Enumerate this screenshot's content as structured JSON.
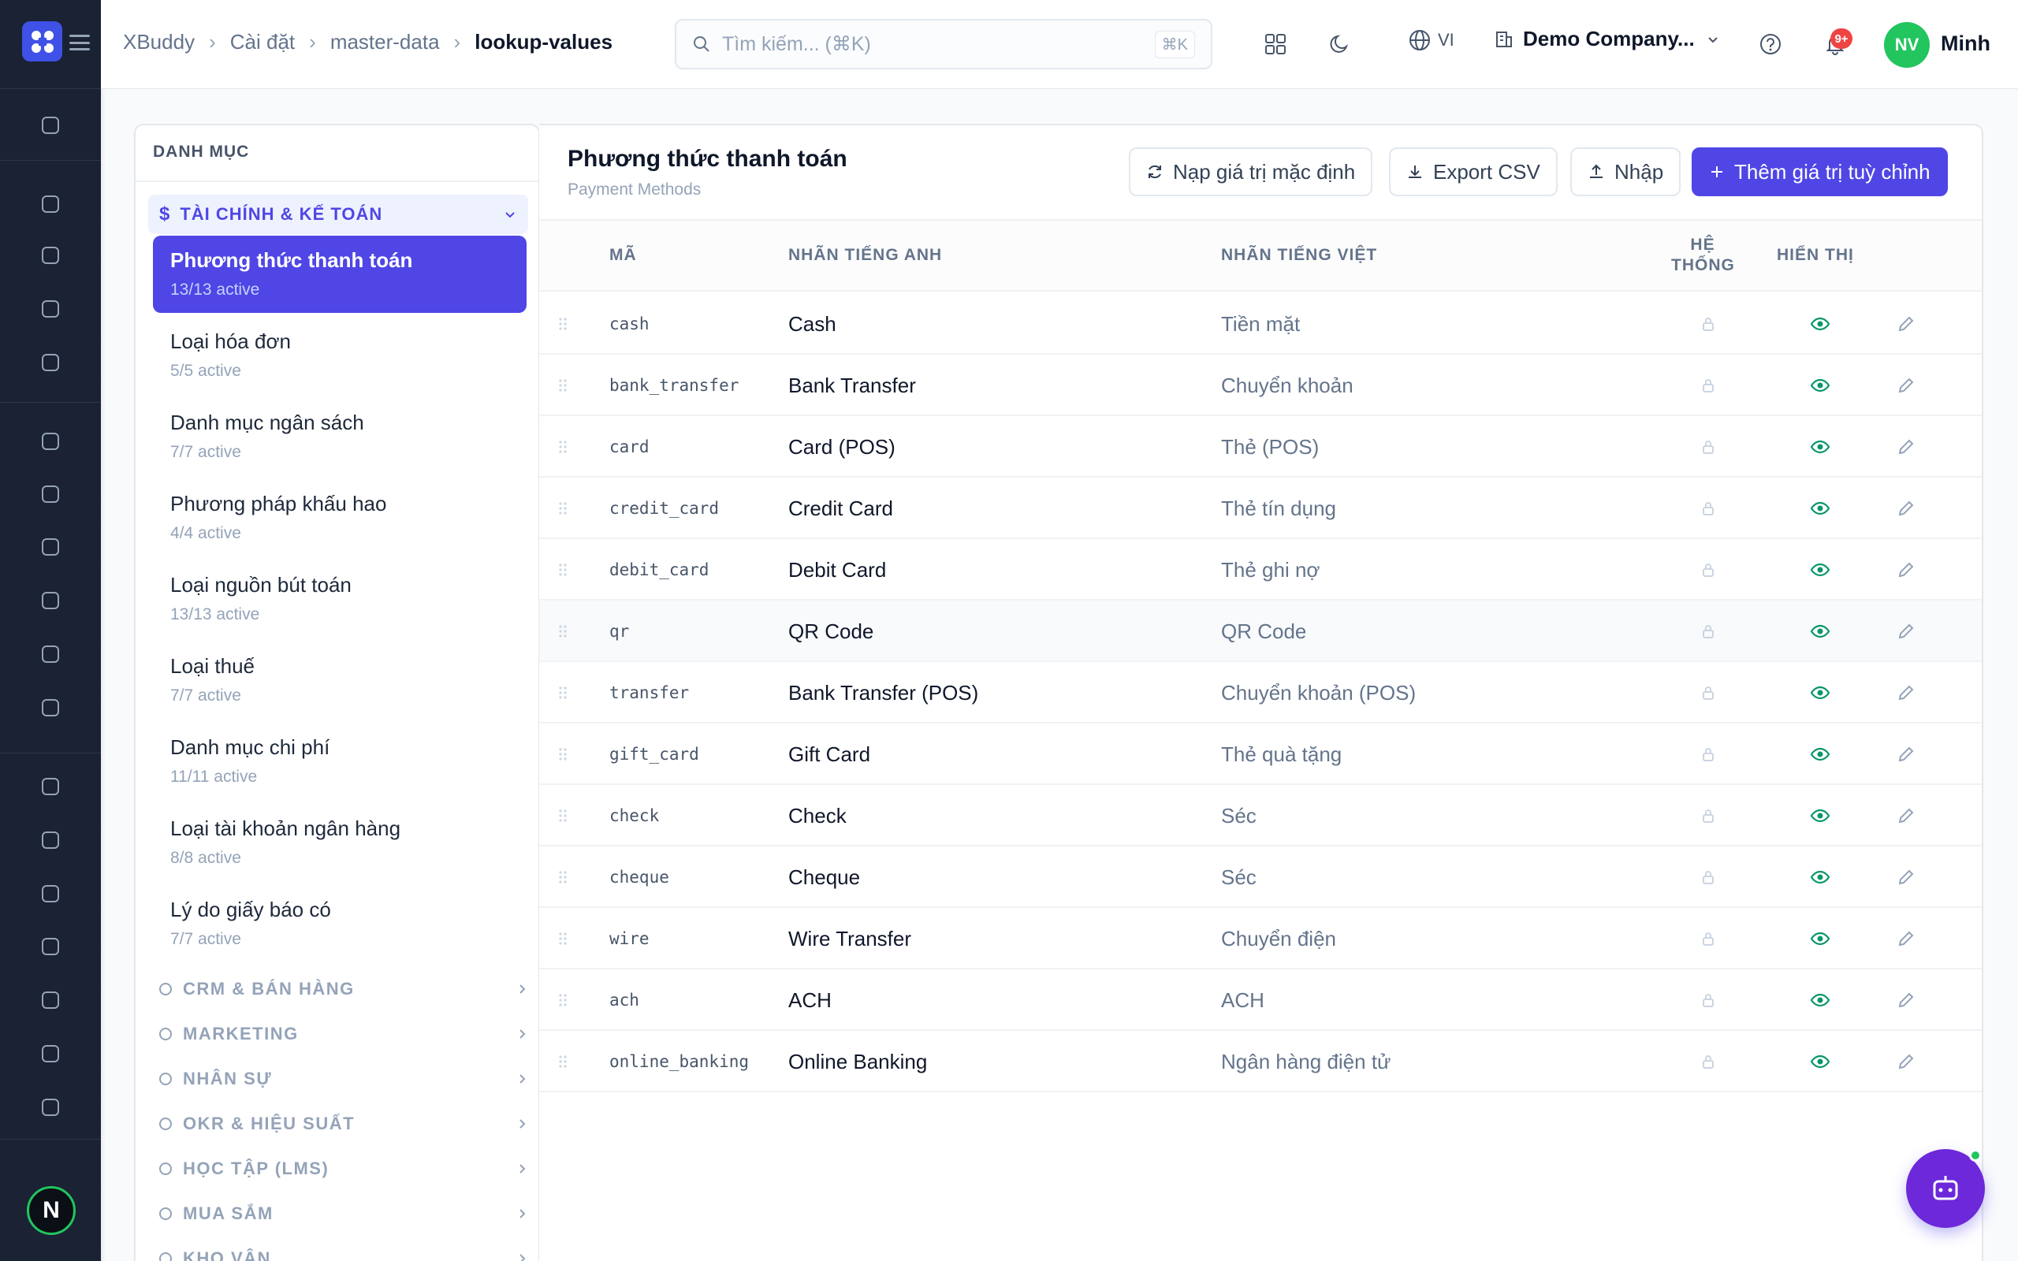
{
  "header": {
    "breadcrumbs": [
      "XBuddy",
      "Cài đặt",
      "master-data",
      "lookup-values"
    ],
    "search_placeholder": "Tìm kiếm... (⌘K)",
    "search_shortcut": "⌘K",
    "language": "VI",
    "company": "Demo Company...",
    "notification_badge": "9+",
    "user_initials": "NV",
    "user_name": "Minh"
  },
  "rail": {
    "icons": [
      "settings-icon",
      "user-circle-icon",
      "monitor-icon",
      "chat-icon",
      "key-icon",
      "building-icon",
      "printer-icon",
      "sitemap-icon",
      "users-icon",
      "shield-check-icon",
      "shield-check-icon",
      "layers-icon",
      "credit-card-icon",
      "gauge-icon",
      "settings-icon",
      "inbox-icon",
      "document-icon",
      "shapes-icon"
    ],
    "avatar_initial": "N"
  },
  "categories": {
    "header": "DANH MỤC",
    "open_group": "TÀI CHÍNH & KẾ TOÁN",
    "items": [
      {
        "name": "Phương thức thanh toán",
        "count": "13/13 active"
      },
      {
        "name": "Loại hóa đơn",
        "count": "5/5 active"
      },
      {
        "name": "Danh mục ngân sách",
        "count": "7/7 active"
      },
      {
        "name": "Phương pháp khấu hao",
        "count": "4/4 active"
      },
      {
        "name": "Loại nguồn bút toán",
        "count": "13/13 active"
      },
      {
        "name": "Loại thuế",
        "count": "7/7 active"
      },
      {
        "name": "Danh mục chi phí",
        "count": "11/11 active"
      },
      {
        "name": "Loại tài khoản ngân hàng",
        "count": "8/8 active"
      },
      {
        "name": "Lý do giấy báo có",
        "count": "7/7 active"
      }
    ],
    "groups": [
      "CRM & BÁN HÀNG",
      "MARKETING",
      "NHÂN SỰ",
      "OKR & HIỆU SUẤT",
      "HỌC TẬP (LMS)",
      "MUA SẮM",
      "KHO VẬN"
    ]
  },
  "main": {
    "title": "Phương thức thanh toán",
    "subtitle": "Payment Methods",
    "buttons": {
      "reset": "Nạp giá trị mặc định",
      "export": "Export CSV",
      "import": "Nhập",
      "add": "Thêm giá trị tuỳ chỉnh"
    },
    "columns": {
      "code": "MÃ",
      "en": "NHÃN TIẾNG ANH",
      "vi": "NHÃN TIẾNG VIỆT",
      "system_1": "HỆ",
      "system_2": "THỐNG",
      "visible": "HIỂN THỊ"
    },
    "rows": [
      {
        "code": "cash",
        "en": "Cash",
        "vi": "Tiền mặt"
      },
      {
        "code": "bank_transfer",
        "en": "Bank Transfer",
        "vi": "Chuyển khoản"
      },
      {
        "code": "card",
        "en": "Card (POS)",
        "vi": "Thẻ (POS)"
      },
      {
        "code": "credit_card",
        "en": "Credit Card",
        "vi": "Thẻ tín dụng"
      },
      {
        "code": "debit_card",
        "en": "Debit Card",
        "vi": "Thẻ ghi nợ"
      },
      {
        "code": "qr",
        "en": "QR Code",
        "vi": "QR Code"
      },
      {
        "code": "transfer",
        "en": "Bank Transfer (POS)",
        "vi": "Chuyển khoản (POS)"
      },
      {
        "code": "gift_card",
        "en": "Gift Card",
        "vi": "Thẻ quà tặng"
      },
      {
        "code": "check",
        "en": "Check",
        "vi": "Séc"
      },
      {
        "code": "cheque",
        "en": "Cheque",
        "vi": "Séc"
      },
      {
        "code": "wire",
        "en": "Wire Transfer",
        "vi": "Chuyển điện"
      },
      {
        "code": "ach",
        "en": "ACH",
        "vi": "ACH"
      },
      {
        "code": "online_banking",
        "en": "Online Banking",
        "vi": "Ngân hàng điện tử"
      }
    ]
  },
  "colors": {
    "accent": "#4f46e5",
    "rail_bg": "#1a2234",
    "visible_icon": "#059669",
    "online": "#22c55e"
  }
}
